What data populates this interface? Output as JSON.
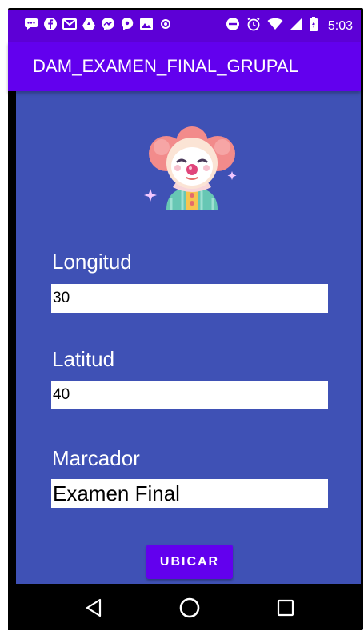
{
  "status_bar": {
    "time": "5:03",
    "icons_left": [
      "message-icon",
      "facebook-icon",
      "gmail-icon",
      "drive-icon",
      "messenger-icon",
      "chat-icon",
      "photo-icon",
      "vpn-icon"
    ],
    "icons_right": [
      "do-not-disturb-icon",
      "alarm-icon",
      "wifi-icon",
      "signal-icon",
      "battery-icon"
    ]
  },
  "app_bar": {
    "title": "DAM_EXAMEN_FINAL_GRUPAL"
  },
  "main": {
    "image": "clown-icon",
    "longitud": {
      "label": "Longitud",
      "value": "30"
    },
    "latitud": {
      "label": "Latitud",
      "value": "40"
    },
    "marcador": {
      "label": "Marcador",
      "value": "Examen Final"
    },
    "ubicar_label": "UBICAR"
  },
  "nav_bar": {
    "icons": [
      "back-icon",
      "home-icon",
      "recents-icon"
    ]
  },
  "colors": {
    "status_bar": "#5d00d6",
    "app_bar": "#6200ee",
    "background": "#3f51b5",
    "button": "#6200ee"
  }
}
